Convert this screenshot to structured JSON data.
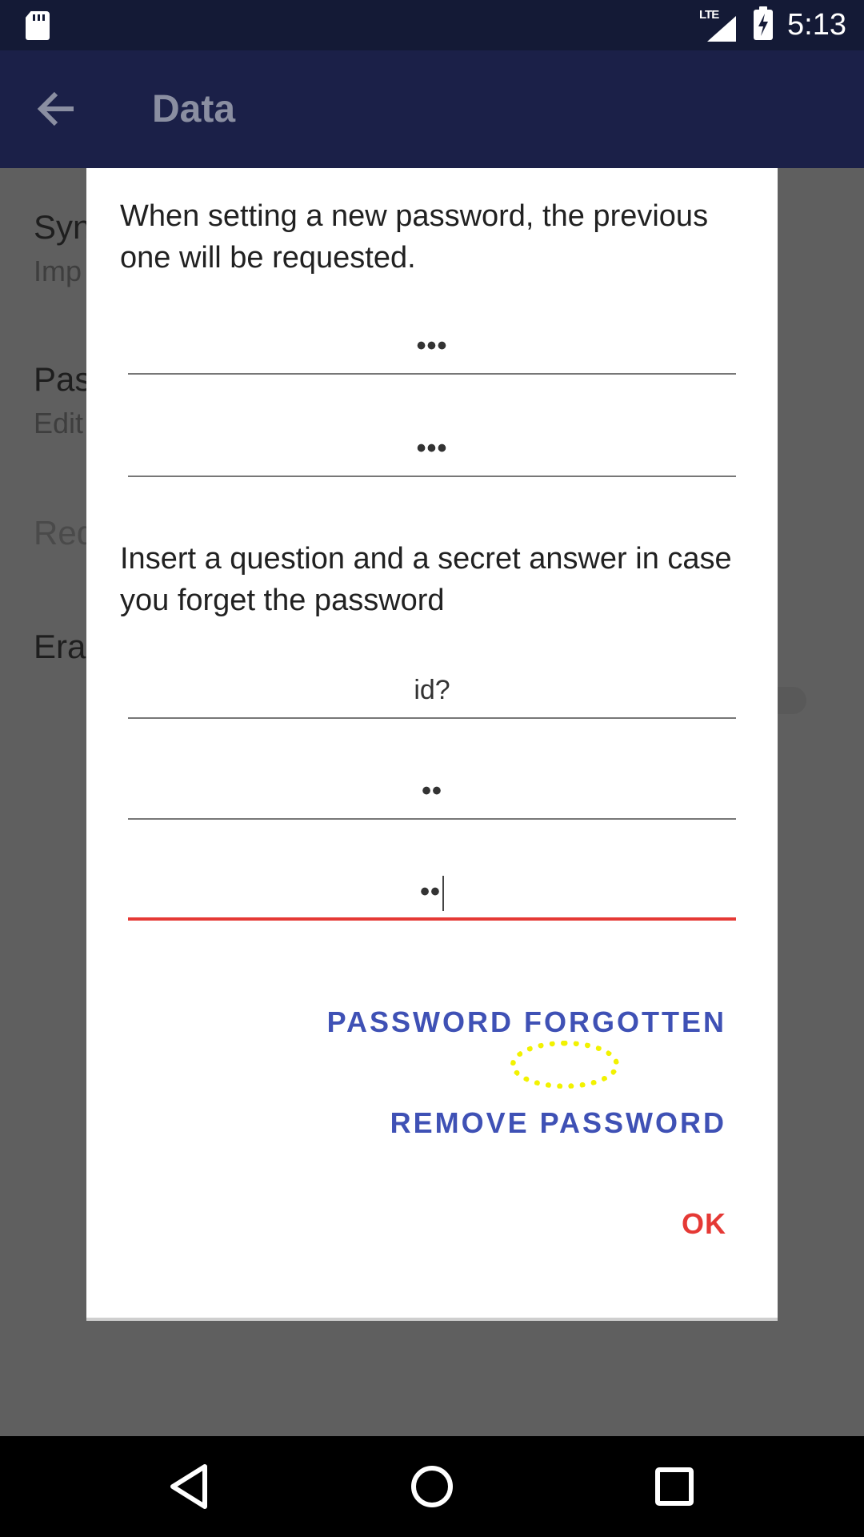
{
  "status_bar": {
    "network_label": "LTE",
    "time": "5:13",
    "icons": [
      "sd-card-icon",
      "lte-signal-icon",
      "battery-charging-icon"
    ]
  },
  "app_bar": {
    "title": "Data",
    "back_icon": "arrow-back-icon"
  },
  "background_settings": [
    {
      "title": "Syn",
      "subtitle": "Imp"
    },
    {
      "title": "Pas",
      "subtitle": "Edit"
    },
    {
      "title": "Req",
      "subtitle": ""
    },
    {
      "title": "Eras",
      "subtitle": ""
    }
  ],
  "dialog": {
    "intro_text": "When setting a new password, the previous one will be requested.",
    "password_field": "•••",
    "confirm_password_field": "•••",
    "question_text": "Insert a question and a secret answer in case you forget the password",
    "question_field": "id?",
    "answer_field": "••",
    "confirm_answer_field": "••",
    "buttons": {
      "password_forgotten": "PASSWORD FORGOTTEN",
      "remove_password": "REMOVE PASSWORD",
      "ok": "OK"
    },
    "colors": {
      "accent": "#3f51b5",
      "error": "#e53935",
      "highlight": "#f2f200"
    }
  },
  "nav_bar": {
    "icons": [
      "nav-back-icon",
      "nav-home-icon",
      "nav-recents-icon"
    ]
  }
}
